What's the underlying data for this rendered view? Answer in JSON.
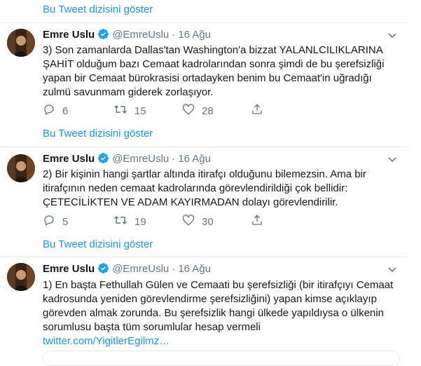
{
  "show_thread_label": "Bu Tweet dizisini göster",
  "tweets": [
    {
      "name": "Emre Uslu",
      "handle": "@EmreUslu",
      "sep": "·",
      "date": "16 Ağu",
      "text_lines": [
        "3) Son zamanlarda Dallas'tan Washington'a bizzat YALANLCILIKLARINA",
        "ŞAHİT olduğum bazı Cemaat kadrolarından sonra şimdi de bu şerefsizliği",
        "yapan bir Cemaat bürokrasisi ortadayken benim bu Cemaat'in uğradığı",
        "zulmü savunmam giderek zorlaşıyor."
      ],
      "replies": "6",
      "retweets": "15",
      "likes": "28"
    },
    {
      "name": "Emre Uslu",
      "handle": "@EmreUslu",
      "sep": "·",
      "date": "16 Ağu",
      "text_lines": [
        "2) Bir kişinin hangi şartlar altında itirafçı olduğunu bilemezsin. Ama bir",
        "itirafçının neden cemaat kadrolarında görevlendirildiği çok bellidir:",
        "ÇETECİLİKTEN VE ADAM KAYIRMADAN dolayı görevlendirilir."
      ],
      "replies": "5",
      "retweets": "19",
      "likes": "30"
    },
    {
      "name": "Emre Uslu",
      "handle": "@EmreUslu",
      "sep": "·",
      "date": "16 Ağu",
      "text_lines": [
        "1) En başta Fethullah Gülen ve Cemaati bu şerefsizliği (bir itirafçıyı Cemaat",
        "kadrosunda yeniden görevlendirme şerefsizliğini) yapan kimse açıklayıp",
        "görevden almak zorunda. Bu şerefsizlik hangi ülkede yapıldıysa o ülkenin",
        "sorumlusu başta tüm sorumlular hesap vermeli"
      ],
      "link": "twitter.com/YigitlerEgilmz…"
    }
  ],
  "colors": {
    "accent": "#1b95e0",
    "muted": "#657786",
    "divider": "#e6ecf0"
  }
}
